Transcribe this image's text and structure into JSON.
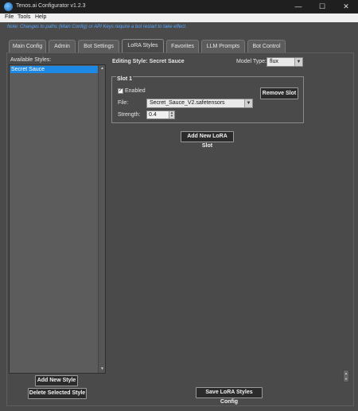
{
  "window": {
    "title": "Tenos.ai Configurator v1.2.3",
    "controls": {
      "minimize": "—",
      "maximize": "☐",
      "close": "✕"
    }
  },
  "menu": {
    "file": "File",
    "tools": "Tools",
    "help": "Help"
  },
  "note": "Note: Changes to paths (Main Config) or API Keys require a bot restart to take effect.",
  "tabs": [
    {
      "label": "Main Config"
    },
    {
      "label": "Admin"
    },
    {
      "label": "Bot Settings"
    },
    {
      "label": "LoRA Styles",
      "active": true
    },
    {
      "label": "Favorites"
    },
    {
      "label": "LLM Prompts"
    },
    {
      "label": "Bot Control"
    }
  ],
  "styles_panel": {
    "label": "Available Styles:",
    "items": [
      "Secret Sauce"
    ],
    "selected": "Secret Sauce",
    "add_button": "Add New Style",
    "delete_button": "Delete Selected Style"
  },
  "editor": {
    "heading": "Editing Style: Secret Sauce",
    "model_type_label": "Model Type:",
    "model_type_value": "flux",
    "slot": {
      "title": "Slot 1",
      "enabled_label": "Enabled",
      "enabled": true,
      "remove_button": "Remove Slot",
      "file_label": "File:",
      "file_value": "Secret_Sauce_V2.safetensors",
      "strength_label": "Strength:",
      "strength_value": "0.4"
    },
    "add_slot_button": "Add New LoRA Slot",
    "save_button": "Save LoRA Styles Config"
  },
  "colors": {
    "accent": "#1e88e5",
    "note": "#5aa7ff",
    "background": "#4a4a4a"
  }
}
